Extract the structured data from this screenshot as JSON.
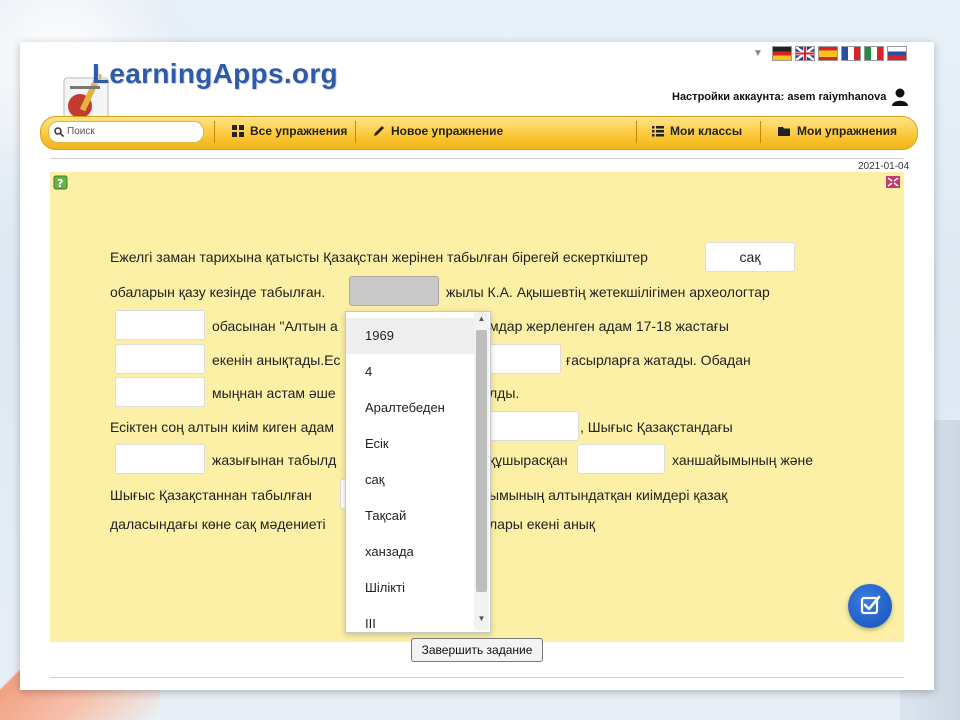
{
  "header": {
    "logo_text": "LearningApps.org",
    "account_text": "Настройки аккаунта: asem raiymhanova"
  },
  "languages": [
    {
      "name": "German",
      "color": "#222222"
    },
    {
      "name": "English",
      "color": "#1f3f8f"
    },
    {
      "name": "Spanish",
      "color": "#d8232a"
    },
    {
      "name": "French",
      "color": "#2a4fa0"
    },
    {
      "name": "Italian",
      "color": "#1e8f3e"
    },
    {
      "name": "Russian",
      "color": "#2a4fa0"
    }
  ],
  "navbar": {
    "search_placeholder": "Поиск",
    "all_exercises": "Все упражнения",
    "new_exercise": "Новое упражнение",
    "my_classes": "Мои классы",
    "my_exercises": "Мои упражнения"
  },
  "date": "2021-01-04",
  "exercise": {
    "line1": "Ежелгі заман тарихына қатысты Қазақстан жерінен табылған бірегей ескерткіштер",
    "line2": "обаларын қазу кезінде табылған.",
    "line2b": "жылы К.А. Ақышевтің жетекшілігімен археологтар",
    "line3a": "обасынан \"Алтын а",
    "line3b": "мдар жерленген адам 17-18 жастағы",
    "line4a": "екенін анықтады.Ес",
    "line4b": "ғасырларға жатады. Обадан",
    "line5a": "мыңнан астам әше",
    "line5b": "лды.",
    "line6a": "Есіктен соң алтын киім киген адам",
    "line6b": ", Шығыс Қазақстандағы",
    "line7a": "жазығынан табылд",
    "line7b": "құшырасқан",
    "line7c": "ханшайымының және",
    "line8a": "Шығыс Қазақстаннан табылған",
    "line8b": "ымының алтындатқан киімдері қазақ",
    "line9a": "даласындағы көне сақ мәдениеті",
    "line9b": "лары екені анық",
    "filled_answer": "сақ"
  },
  "dropdown_options": [
    "1969",
    "4",
    "Аралтебеден",
    "Есік",
    "сақ",
    "Тақсай",
    "ханзада",
    "Шілікті",
    "III"
  ],
  "dropdown_selected": "1969",
  "finish_button": "Завершить задание",
  "colors": {
    "navbar": "#fbc734",
    "content_bg": "#fcf0a6",
    "logo": "#2f5aa8",
    "check_button": "#1552b8"
  }
}
